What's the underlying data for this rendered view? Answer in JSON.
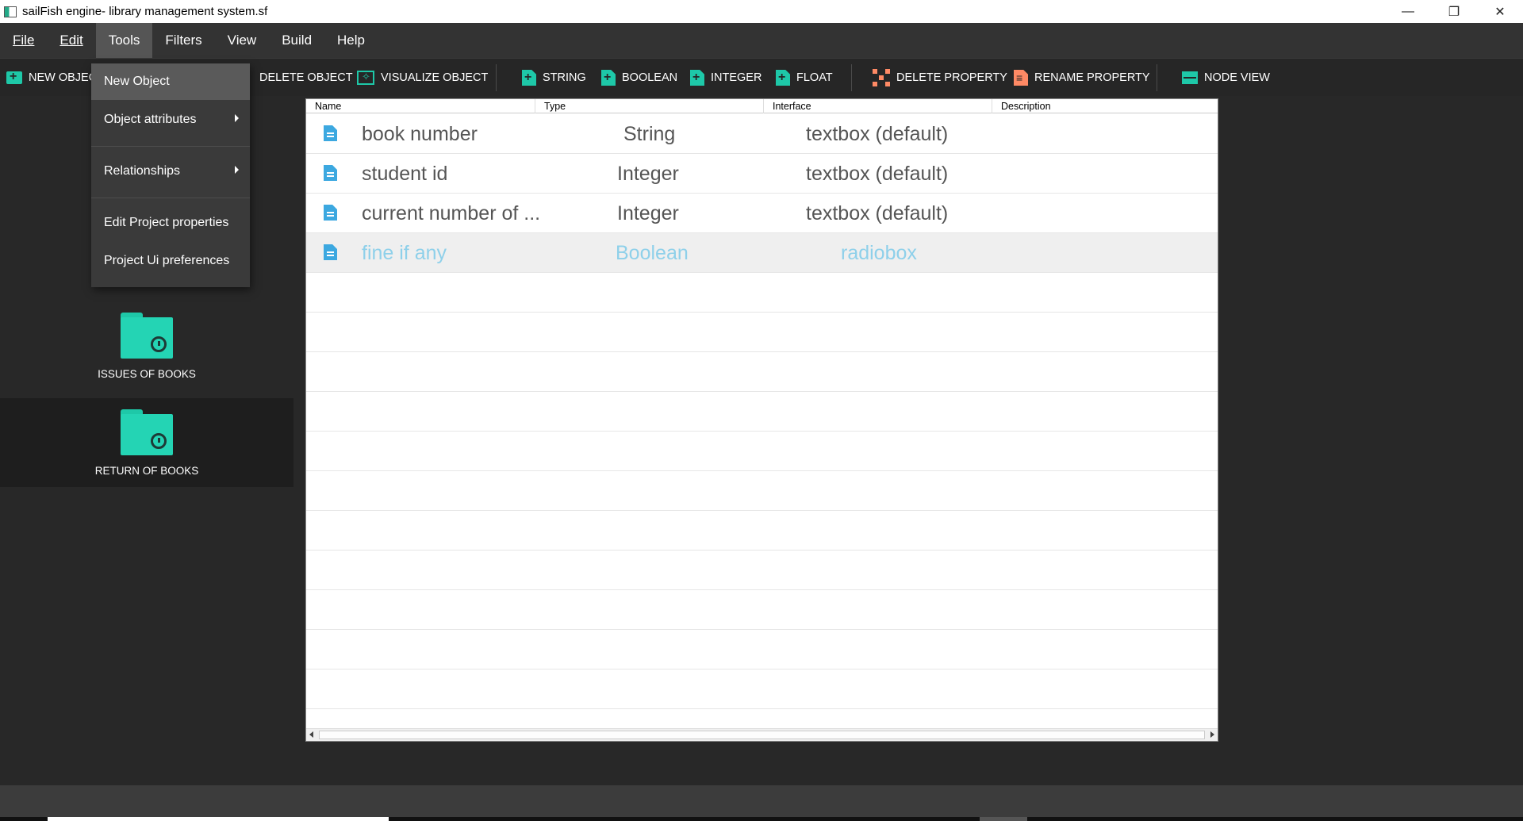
{
  "window": {
    "title": "sailFish engine- library management system.sf",
    "controls": [
      "—",
      "❐",
      "✕"
    ]
  },
  "menubar": [
    {
      "label": "File"
    },
    {
      "label": "Edit"
    },
    {
      "label": "Tools"
    },
    {
      "label": "Filters"
    },
    {
      "label": "View"
    },
    {
      "label": "Build"
    },
    {
      "label": "Help"
    }
  ],
  "toolbar": {
    "new_object": "NEW OBJECT",
    "delete_object": "DELETE OBJECT",
    "visualize_object": "VISUALIZE OBJECT",
    "string": "STRING",
    "boolean": "BOOLEAN",
    "integer": "INTEGER",
    "float": "FLOAT",
    "delete_property": "DELETE PROPERTY",
    "rename_property": "RENAME PROPERTY",
    "node_view": "NODE VIEW"
  },
  "tools_menu": {
    "items": [
      {
        "label": "New Object"
      },
      {
        "label": "Object attributes"
      },
      {
        "label": "Relationships"
      },
      {
        "label": "Edit Project properties"
      },
      {
        "label": "Project Ui preferences"
      }
    ]
  },
  "objects": [
    {
      "label": "ISSUES OF BOOKS"
    },
    {
      "label": "RETURN OF BOOKS"
    }
  ],
  "table": {
    "headers": [
      "Name",
      "Type",
      "Interface",
      "Description"
    ],
    "rows": [
      {
        "name": "book number",
        "type": "String",
        "interface": "textbox (default)",
        "description": ""
      },
      {
        "name": "student id",
        "type": "Integer",
        "interface": "textbox (default)",
        "description": ""
      },
      {
        "name": "current number of  ...",
        "type": "Integer",
        "interface": "textbox (default)",
        "description": ""
      },
      {
        "name": "fine if any",
        "type": "Boolean",
        "interface": "radiobox",
        "description": ""
      }
    ]
  },
  "colors": {
    "accent": "#1ec8a8",
    "row_icon": "#3ca8e0",
    "selected_text": "#8ed0ea",
    "warning_icon": "#ff8a65"
  }
}
